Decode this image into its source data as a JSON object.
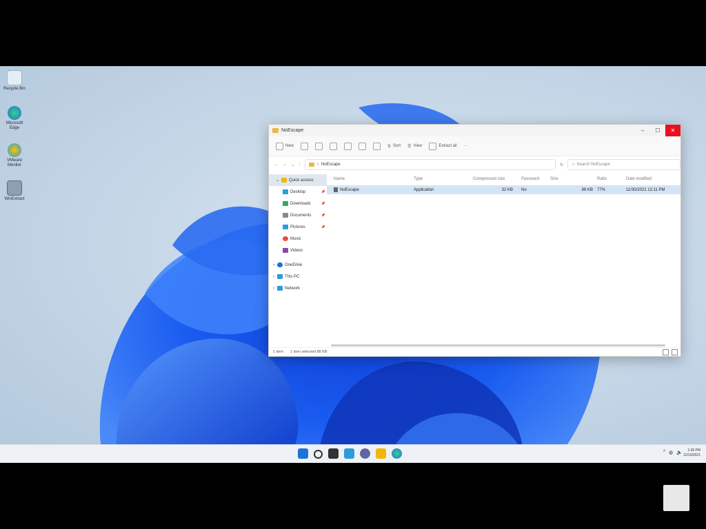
{
  "desktop": {
    "icons": [
      {
        "label": "Recycle Bin",
        "icon": "recycle-bin-icon"
      },
      {
        "label": "Microsoft Edge",
        "icon": "edge-icon"
      },
      {
        "label": "VMware Monitor",
        "icon": "vmware-icon"
      },
      {
        "label": "WinExtract",
        "icon": "app-icon"
      }
    ]
  },
  "explorer": {
    "title": "NoEscape",
    "toolbar": {
      "new": "New",
      "sort": "Sort",
      "view": "View",
      "extract_all": "Extract all",
      "more": "···"
    },
    "address": {
      "path_sep": "›",
      "path": "NoEscape",
      "search_placeholder": "Search NoEscape"
    },
    "nav": {
      "quick_access": "Quick access",
      "items": [
        {
          "label": "Desktop",
          "icon": "desktop-icon",
          "color": "#2d9cdb"
        },
        {
          "label": "Downloads",
          "icon": "downloads-icon",
          "color": "#27ae60"
        },
        {
          "label": "Documents",
          "icon": "documents-icon",
          "color": "#7f8c8d"
        },
        {
          "label": "Pictures",
          "icon": "pictures-icon",
          "color": "#2d9cdb"
        },
        {
          "label": "Music",
          "icon": "music-icon",
          "color": "#e74c3c"
        },
        {
          "label": "Videos",
          "icon": "videos-icon",
          "color": "#8e44ad"
        }
      ],
      "onedrive": "OneDrive",
      "this_pc": "This PC",
      "network": "Network"
    },
    "columns": [
      "Name",
      "Type",
      "Compressed size",
      "Password",
      "Size",
      "Ratio",
      "Date modified"
    ],
    "rows": [
      {
        "name": "NoEscape",
        "type": "Application",
        "compressed": "32 KB",
        "password": "No",
        "size": "88 KB",
        "ratio": "77%",
        "date": "11/30/2021 12:11 PM"
      }
    ],
    "status": {
      "items": "1 item",
      "selected": "1 item selected  88 KB"
    }
  },
  "taskbar": {
    "time": "1:36 PM",
    "date": "12/10/2021",
    "tray_chevron": "^"
  },
  "colors": {
    "accent": "#1a73d6",
    "selection": "#d3e4f6",
    "close": "#e81123"
  }
}
